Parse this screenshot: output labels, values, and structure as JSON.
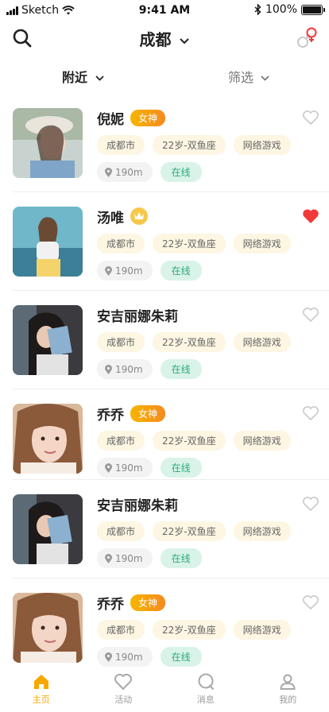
{
  "status_bar": {
    "carrier": "Sketch",
    "time": "9:41 AM",
    "battery": "100%"
  },
  "header": {
    "city": "成都"
  },
  "filter": {
    "nearby": "附近",
    "filter": "筛选"
  },
  "colors": {
    "accent": "#F7A800",
    "online_text": "#2AAA7A",
    "heart_red": "#F03A3A"
  },
  "users": [
    {
      "name": "倪妮",
      "badge": "女神",
      "badge_type": "goddess",
      "tags": [
        "成都市",
        "22岁-双鱼座",
        "网络游戏"
      ],
      "distance": "190m",
      "status": "在线",
      "liked": false
    },
    {
      "name": "汤唯",
      "badge": "",
      "badge_type": "crown",
      "tags": [
        "成都市",
        "22岁-双鱼座",
        "网络游戏"
      ],
      "distance": "190m",
      "status": "在线",
      "liked": true
    },
    {
      "name": "安吉丽娜朱莉",
      "badge": "",
      "badge_type": "none",
      "tags": [
        "成都市",
        "22岁-双鱼座",
        "网络游戏"
      ],
      "distance": "190m",
      "status": "在线",
      "liked": false
    },
    {
      "name": "乔乔",
      "badge": "女神",
      "badge_type": "goddess",
      "tags": [
        "成都市",
        "22岁-双鱼座",
        "网络游戏"
      ],
      "distance": "190m",
      "status": "在线",
      "liked": false
    },
    {
      "name": "安吉丽娜朱莉",
      "badge": "",
      "badge_type": "none",
      "tags": [
        "成都市",
        "22岁-双鱼座",
        "网络游戏"
      ],
      "distance": "190m",
      "status": "在线",
      "liked": false
    },
    {
      "name": "乔乔",
      "badge": "女神",
      "badge_type": "goddess",
      "tags": [
        "成都市",
        "22岁-双鱼座",
        "网络游戏"
      ],
      "distance": "190m",
      "status": "在线",
      "liked": false
    }
  ],
  "tabs": [
    {
      "label": "主页",
      "icon": "home-icon",
      "active": true
    },
    {
      "label": "活动",
      "icon": "heart-outline-icon",
      "active": false
    },
    {
      "label": "消息",
      "icon": "chat-bubble-icon",
      "active": false
    },
    {
      "label": "我的",
      "icon": "person-icon",
      "active": false
    }
  ]
}
